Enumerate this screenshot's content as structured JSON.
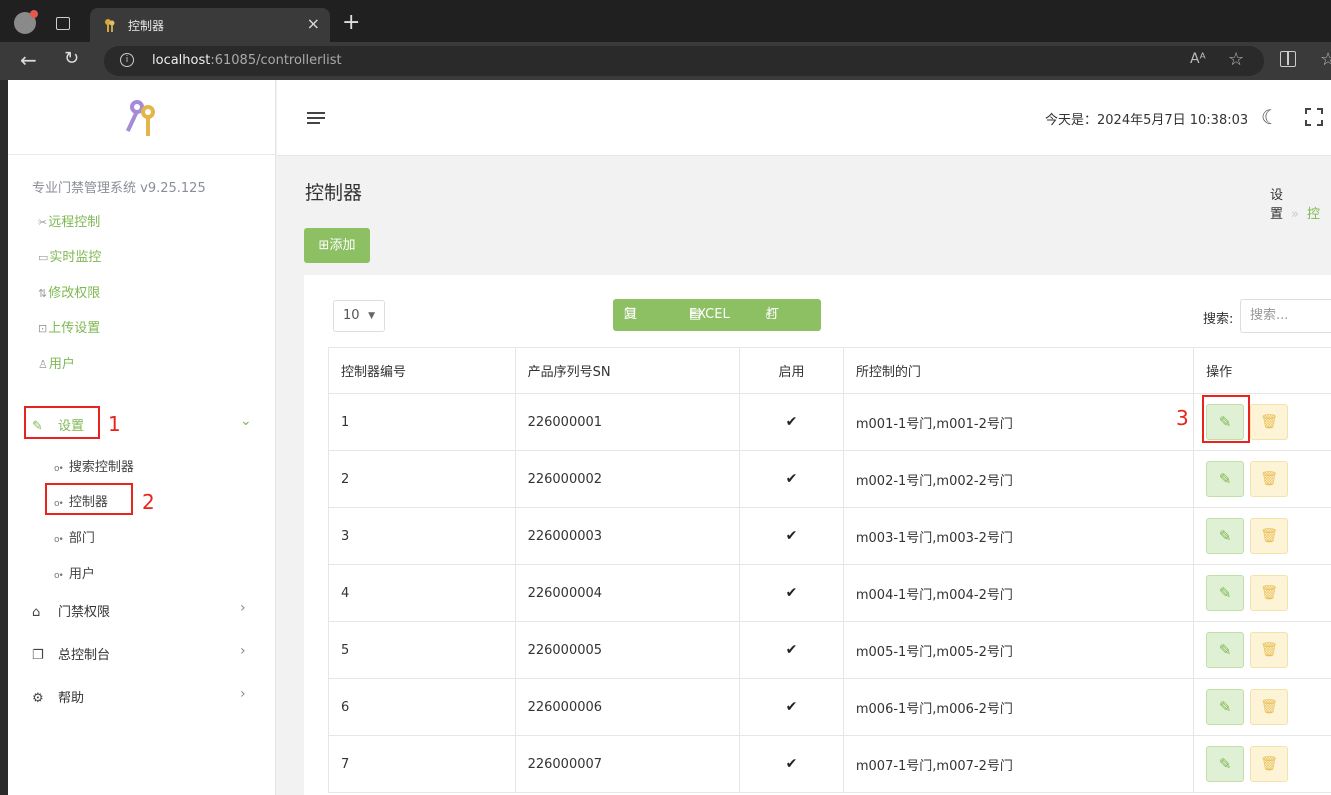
{
  "browser": {
    "tab_title": "控制器",
    "tab_close": "×",
    "new_tab": "+",
    "url_host": "localhost",
    "url_rest": ":61085/controllerlist",
    "read_aloud": "Aᴬ"
  },
  "sidebar": {
    "system_name": "专业门禁管理系统 v9.25.125",
    "quick_links": [
      {
        "icon": "remote-icon",
        "label": "远程控制"
      },
      {
        "icon": "monitor-icon",
        "label": "实时监控"
      },
      {
        "icon": "permission-icon",
        "label": "修改权限"
      },
      {
        "icon": "upload-icon",
        "label": "上传设置"
      },
      {
        "icon": "users-icon",
        "label": "用户"
      }
    ],
    "menu": {
      "settings": "设置",
      "settings_sub": [
        "搜索控制器",
        "控制器",
        "部门",
        "用户"
      ],
      "access": "门禁权限",
      "console": "总控制台",
      "help": "帮助"
    }
  },
  "annotations": [
    "1",
    "2",
    "3"
  ],
  "header": {
    "today": "今天是：2024年5月7日 10:38:03"
  },
  "page": {
    "title": "控制器",
    "breadcrumb": "设置",
    "breadcrumb_next": "控",
    "add_button": "添加",
    "page_length": "10",
    "export_buttons": {
      "copy": "复制",
      "excel": "EXCEL",
      "print": "打印"
    },
    "search_label": "搜索:",
    "search_placeholder": "搜索..."
  },
  "table": {
    "columns": [
      "控制器编号",
      "产品序列号SN",
      "启用",
      "所控制的门",
      "操作"
    ],
    "rows": [
      {
        "id": "1",
        "sn": "226000001",
        "enabled": "✔",
        "doors": "m001-1号门,m001-2号门"
      },
      {
        "id": "2",
        "sn": "226000002",
        "enabled": "✔",
        "doors": "m002-1号门,m002-2号门"
      },
      {
        "id": "3",
        "sn": "226000003",
        "enabled": "✔",
        "doors": "m003-1号门,m003-2号门"
      },
      {
        "id": "4",
        "sn": "226000004",
        "enabled": "✔",
        "doors": "m004-1号门,m004-2号门"
      },
      {
        "id": "5",
        "sn": "226000005",
        "enabled": "✔",
        "doors": "m005-1号门,m005-2号门"
      },
      {
        "id": "6",
        "sn": "226000006",
        "enabled": "✔",
        "doors": "m006-1号门,m006-2号门"
      },
      {
        "id": "7",
        "sn": "226000007",
        "enabled": "✔",
        "doors": "m007-1号门,m007-2号门"
      }
    ]
  },
  "colors": {
    "accent": "#8cc063",
    "annotation": "#e8241c",
    "warn": "#e9bf55"
  }
}
